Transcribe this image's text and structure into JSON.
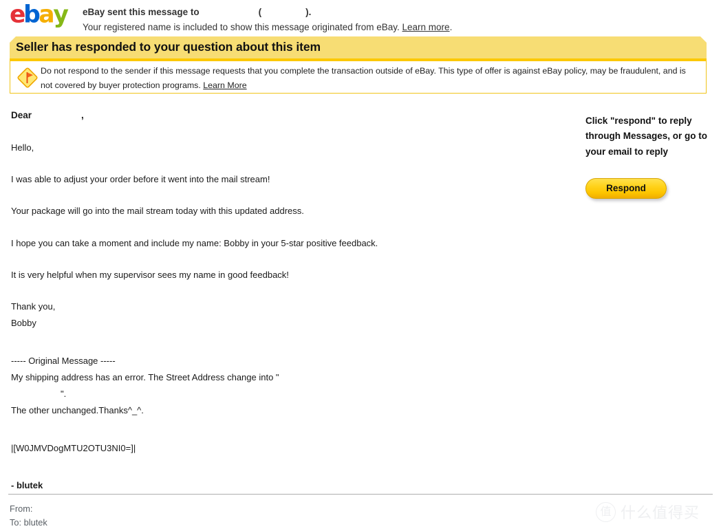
{
  "header": {
    "logo_alt": "eBay",
    "logo_colors": {
      "e": "#e53238",
      "b": "#0064d2",
      "a": "#f5af02",
      "y": "#86b817"
    },
    "line1_prefix": "eBay sent this message to",
    "line1_open_paren": "(",
    "line1_close_paren": ").",
    "line1_recipient_redacted": "",
    "line1_userid_redacted": "",
    "line2": "Your registered name is included to show this message originated from eBay.",
    "learn_more_link": "Learn more",
    "line2_period": "."
  },
  "banner": {
    "title": "Seller has responded to your question about this item",
    "background_color": "#f7dd74",
    "underline_color": "#fcc800"
  },
  "warning": {
    "icon_name": "flag-diamond-warning-icon",
    "text_part1": "Do not respond to the sender if this message requests that you complete the transaction outside of eBay. This type of offer is against eBay policy, may be fraudulent, and is not covered by buyer protection programs.",
    "learn_more_link": "Learn More",
    "border_color": "#f0c419"
  },
  "message": {
    "salutation_label": "Dear",
    "salutation_name_redacted": "",
    "salutation_comma": ",",
    "lines": [
      "Hello,",
      "I was able to adjust your order before it went into the mail stream!",
      "Your package will go into the mail stream today with this updated address.",
      "I hope you can take a moment and include my name: Bobby in your 5-star positive feedback.",
      "It is very helpful when my supervisor sees my name in good feedback!"
    ],
    "closing_thanks": "Thank you,",
    "closing_name": "Bobby",
    "original_message_header": "----- Original Message -----",
    "original_line1": "My shipping address has an error. The Street Address change into \"",
    "original_line2_redacted": "",
    "original_line2_suffix": "\".",
    "original_line3": "The other unchanged.Thanks^_^.",
    "token": "|[W0JMVDogMTU2OTU3NI0=]|",
    "signature": "- blutek"
  },
  "right_panel": {
    "note_line1": "Click \"respond\" to reply",
    "note_line2": "through Messages, or go to",
    "note_line3": "your email to reply",
    "respond_button_label": "Respond"
  },
  "footer": {
    "from_label": "From:",
    "from_value_redacted": "",
    "to_label": "To:",
    "to_value": "blutek"
  },
  "watermark": {
    "mark_char": "值",
    "text": "什么值得买"
  }
}
